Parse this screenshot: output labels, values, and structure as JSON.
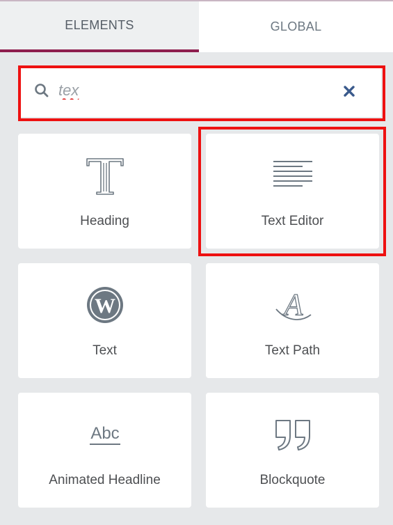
{
  "tabs": [
    {
      "label": "ELEMENTS",
      "active": true
    },
    {
      "label": "GLOBAL",
      "active": false
    }
  ],
  "search": {
    "value": "tex",
    "placeholder": "",
    "icon": "search-icon",
    "clear_icon": "close-icon"
  },
  "widgets": [
    {
      "label": "Heading",
      "icon": "heading-icon"
    },
    {
      "label": "Text Editor",
      "icon": "text-editor-icon"
    },
    {
      "label": "Text",
      "icon": "wordpress-icon"
    },
    {
      "label": "Text Path",
      "icon": "text-path-icon"
    },
    {
      "label": "Animated Headline",
      "icon": "animated-headline-icon",
      "icon_text": "Abc"
    },
    {
      "label": "Blockquote",
      "icon": "blockquote-icon"
    }
  ],
  "colors": {
    "accent": "#8e1d4e",
    "highlight": "#ee1111",
    "panel_bg": "#e6e8ea",
    "icon": "#6d7882"
  }
}
